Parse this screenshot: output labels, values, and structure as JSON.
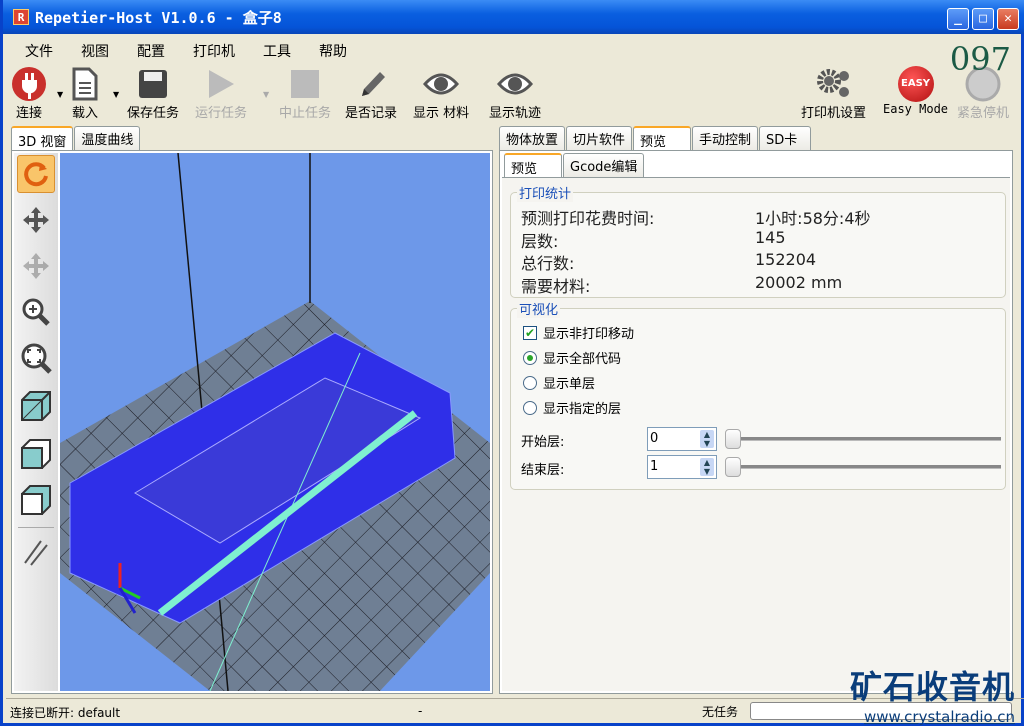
{
  "window": {
    "title": "Repetier-Host V1.0.6 - 盒子8",
    "logo": "R",
    "minimize": "_",
    "maximize": "□",
    "close": "✕"
  },
  "menu": [
    "文件",
    "视图",
    "配置",
    "打印机",
    "工具",
    "帮助"
  ],
  "toolbar": {
    "connect": "连接",
    "load": "载入",
    "save_job": "保存任务",
    "run_job": "运行任务",
    "stop_job": "中止任务",
    "log": "是否记录",
    "show_material": "显示 材料",
    "show_path": "显示轨迹",
    "printer_settings": "打印机设置",
    "easy_mode": "Easy Mode",
    "easy_badge": "EASY",
    "emergency_stop": "紧急停机"
  },
  "counter": "097",
  "left_tabs": [
    "3D 视窗",
    "温度曲线"
  ],
  "right_tabs": [
    "物体放置",
    "切片软件",
    "预览",
    "手动控制",
    "SD卡"
  ],
  "sub_tabs": [
    "预览",
    "Gcode编辑"
  ],
  "stats": {
    "title": "打印统计",
    "rows": [
      {
        "label": "预测打印花费时间:",
        "value": "1小时:58分:4秒"
      },
      {
        "label": "层数:",
        "value": "145"
      },
      {
        "label": "总行数:",
        "value": "152204"
      },
      {
        "label": "需要材料:",
        "value": "20002 mm"
      }
    ]
  },
  "visual": {
    "title": "可视化",
    "show_travel": "显示非打印移动",
    "show_travel_checked": true,
    "radios": [
      "显示全部代码",
      "显示单层",
      "显示指定的层"
    ],
    "selected_radio": 0,
    "start_label": "开始层:",
    "start_value": "0",
    "end_label": "结束层:",
    "end_value": "1",
    "start_slider": 0,
    "end_slider": 0
  },
  "status": {
    "connection": "连接已断开: default",
    "middle": "-",
    "job": "无任务"
  },
  "watermark": {
    "title": "矿石收音机",
    "url": "www.crystalradio.cn"
  },
  "colors": {
    "accent": "#f9a727",
    "group_title": "#1a4fb8",
    "view_bg": "#6d98e9",
    "object": "#2f2fe8",
    "path": "#7ff0d0"
  }
}
